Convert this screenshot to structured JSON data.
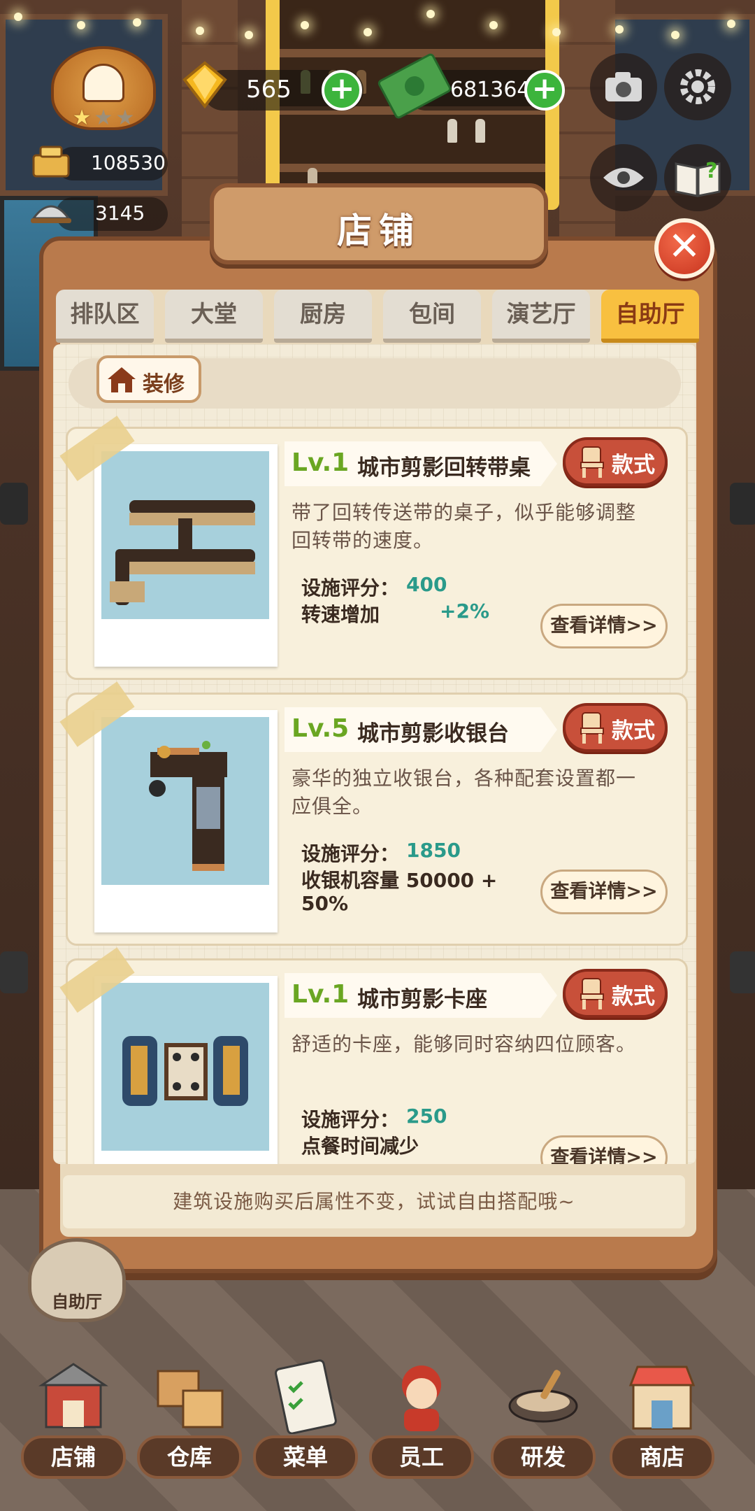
{
  "hud": {
    "gems": "565",
    "cash": "6813649",
    "stat_top": "108530",
    "stat_bottom": "3145",
    "rank_stars_filled": 1,
    "rank_stars_total": 3
  },
  "panel": {
    "title": "店铺",
    "tabs": [
      {
        "label": "排队区",
        "active": false
      },
      {
        "label": "大堂",
        "active": false
      },
      {
        "label": "厨房",
        "active": false
      },
      {
        "label": "包间",
        "active": false
      },
      {
        "label": "演艺厅",
        "active": false
      },
      {
        "label": "自助厅",
        "active": true
      }
    ],
    "decor_label": "装修",
    "style_label": "款式",
    "detail_label": "查看详情>>",
    "rating_label": "设施评分：",
    "items": [
      {
        "level": "Lv.1",
        "name": "城市剪影回转带桌",
        "description": "带了回转传送带的桌子，似乎能够调整回转带的速度。",
        "rating": "400",
        "effect_label": "转速增加",
        "effect_value": "+2%"
      },
      {
        "level": "Lv.5",
        "name": "城市剪影收银台",
        "description": "豪华的独立收银台，各种配套设置都一应俱全。",
        "rating": "1850",
        "effect_label": "收银机容量 50000 +",
        "effect_label_2": "50%"
      },
      {
        "level": "Lv.1",
        "name": "城市剪影卡座",
        "description": "舒适的卡座，能够同时容纳四位顾客。",
        "rating": "250",
        "effect_label": "点餐时间减少"
      }
    ],
    "footer_note": "建筑设施购买后属性不变，试试自由搭配哦~"
  },
  "zone_badge": "自助厅",
  "bottom_nav": [
    {
      "label": "店铺",
      "icon": "shop-building-icon"
    },
    {
      "label": "仓库",
      "icon": "warehouse-boxes-icon"
    },
    {
      "label": "菜单",
      "icon": "menu-clipboard-icon"
    },
    {
      "label": "员工",
      "icon": "staff-character-icon"
    },
    {
      "label": "研发",
      "icon": "research-wok-icon"
    },
    {
      "label": "商店",
      "icon": "store-icon"
    }
  ],
  "colors": {
    "accent_green": "#6aa622",
    "stat_teal": "#2a9a8a",
    "tab_active": "#f8c040",
    "style_button": "#c8503a",
    "panel_wood": "#b97a4c"
  }
}
